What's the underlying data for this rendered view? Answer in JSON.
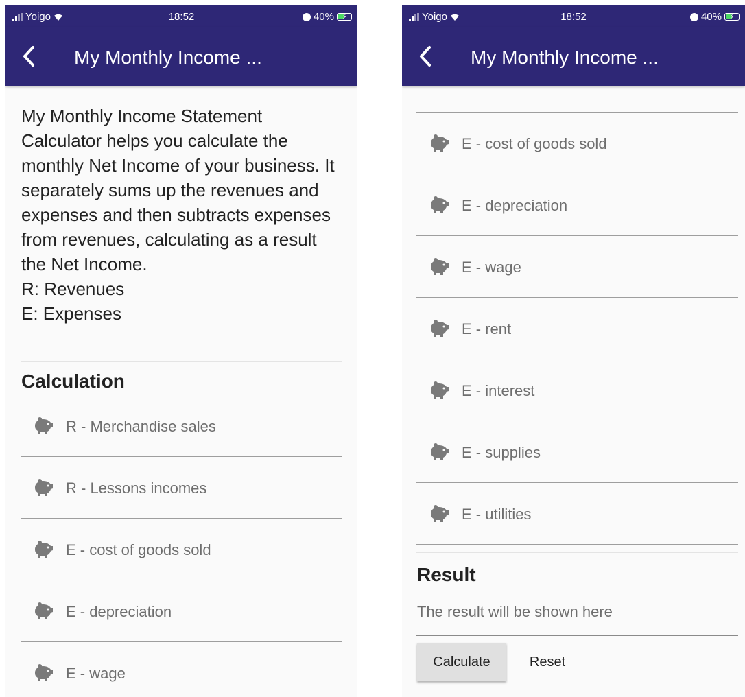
{
  "status_bar": {
    "carrier": "Yoigo",
    "time": "18:52",
    "battery": "40%",
    "battery_level": 0.4
  },
  "app_bar": {
    "title": "My Monthly Income ...",
    "back_icon": "chevron-left-icon"
  },
  "colors": {
    "app_bar": "#2e2776",
    "background": "#fafafa",
    "icon": "#7a7a7a",
    "label": "#6e6e6e",
    "battery_charging": "#4cd964"
  },
  "intro": {
    "description": "My Monthly Income Statement Calculator helps you calculate the monthly Net Income of your business. It separately sums up the revenues and expenses and then subtracts expenses from revenues, calculating as a result the Net Income.",
    "legend_r": "R: Revenues",
    "legend_e": "E: Expenses"
  },
  "calculation": {
    "title": "Calculation",
    "field_icon": "piggy-bank-icon",
    "fields": [
      {
        "label": "R - Merchandise sales"
      },
      {
        "label": "R - Lessons incomes"
      },
      {
        "label": "E - cost of goods sold"
      },
      {
        "label": "E - depreciation"
      },
      {
        "label": "E - wage"
      },
      {
        "label": "E - rent"
      },
      {
        "label": "E - interest"
      },
      {
        "label": "E - supplies"
      },
      {
        "label": "E - utilities"
      }
    ]
  },
  "result": {
    "title": "Result",
    "placeholder": "The result will be shown here"
  },
  "buttons": {
    "calculate": "Calculate",
    "reset": "Reset"
  }
}
